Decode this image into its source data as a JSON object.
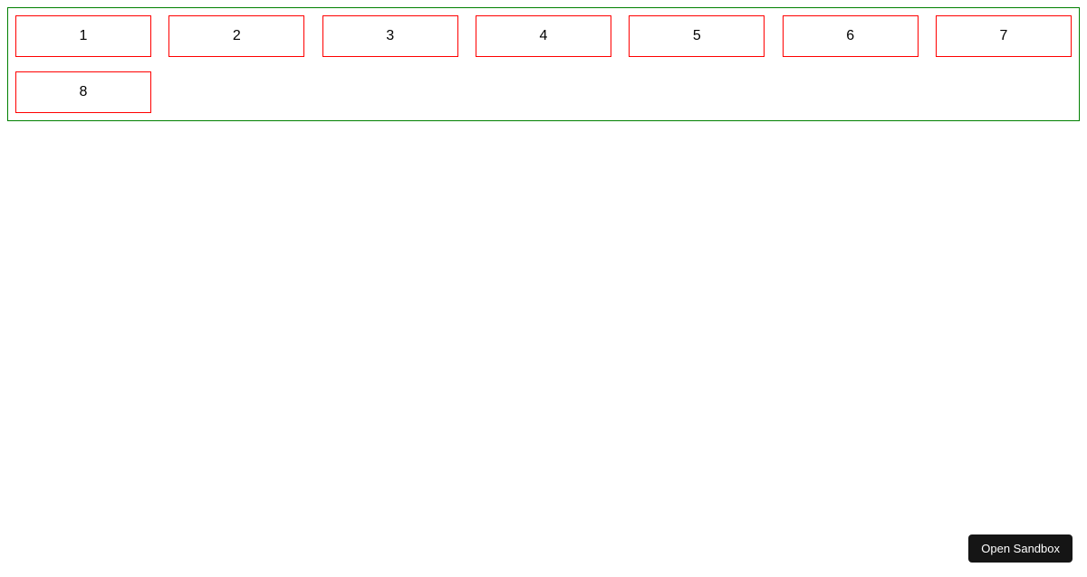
{
  "container": {
    "borderColor": "#008000"
  },
  "items": [
    {
      "label": "1"
    },
    {
      "label": "2"
    },
    {
      "label": "3"
    },
    {
      "label": "4"
    },
    {
      "label": "5"
    },
    {
      "label": "6"
    },
    {
      "label": "7"
    },
    {
      "label": "8"
    }
  ],
  "button": {
    "label": "Open Sandbox"
  }
}
